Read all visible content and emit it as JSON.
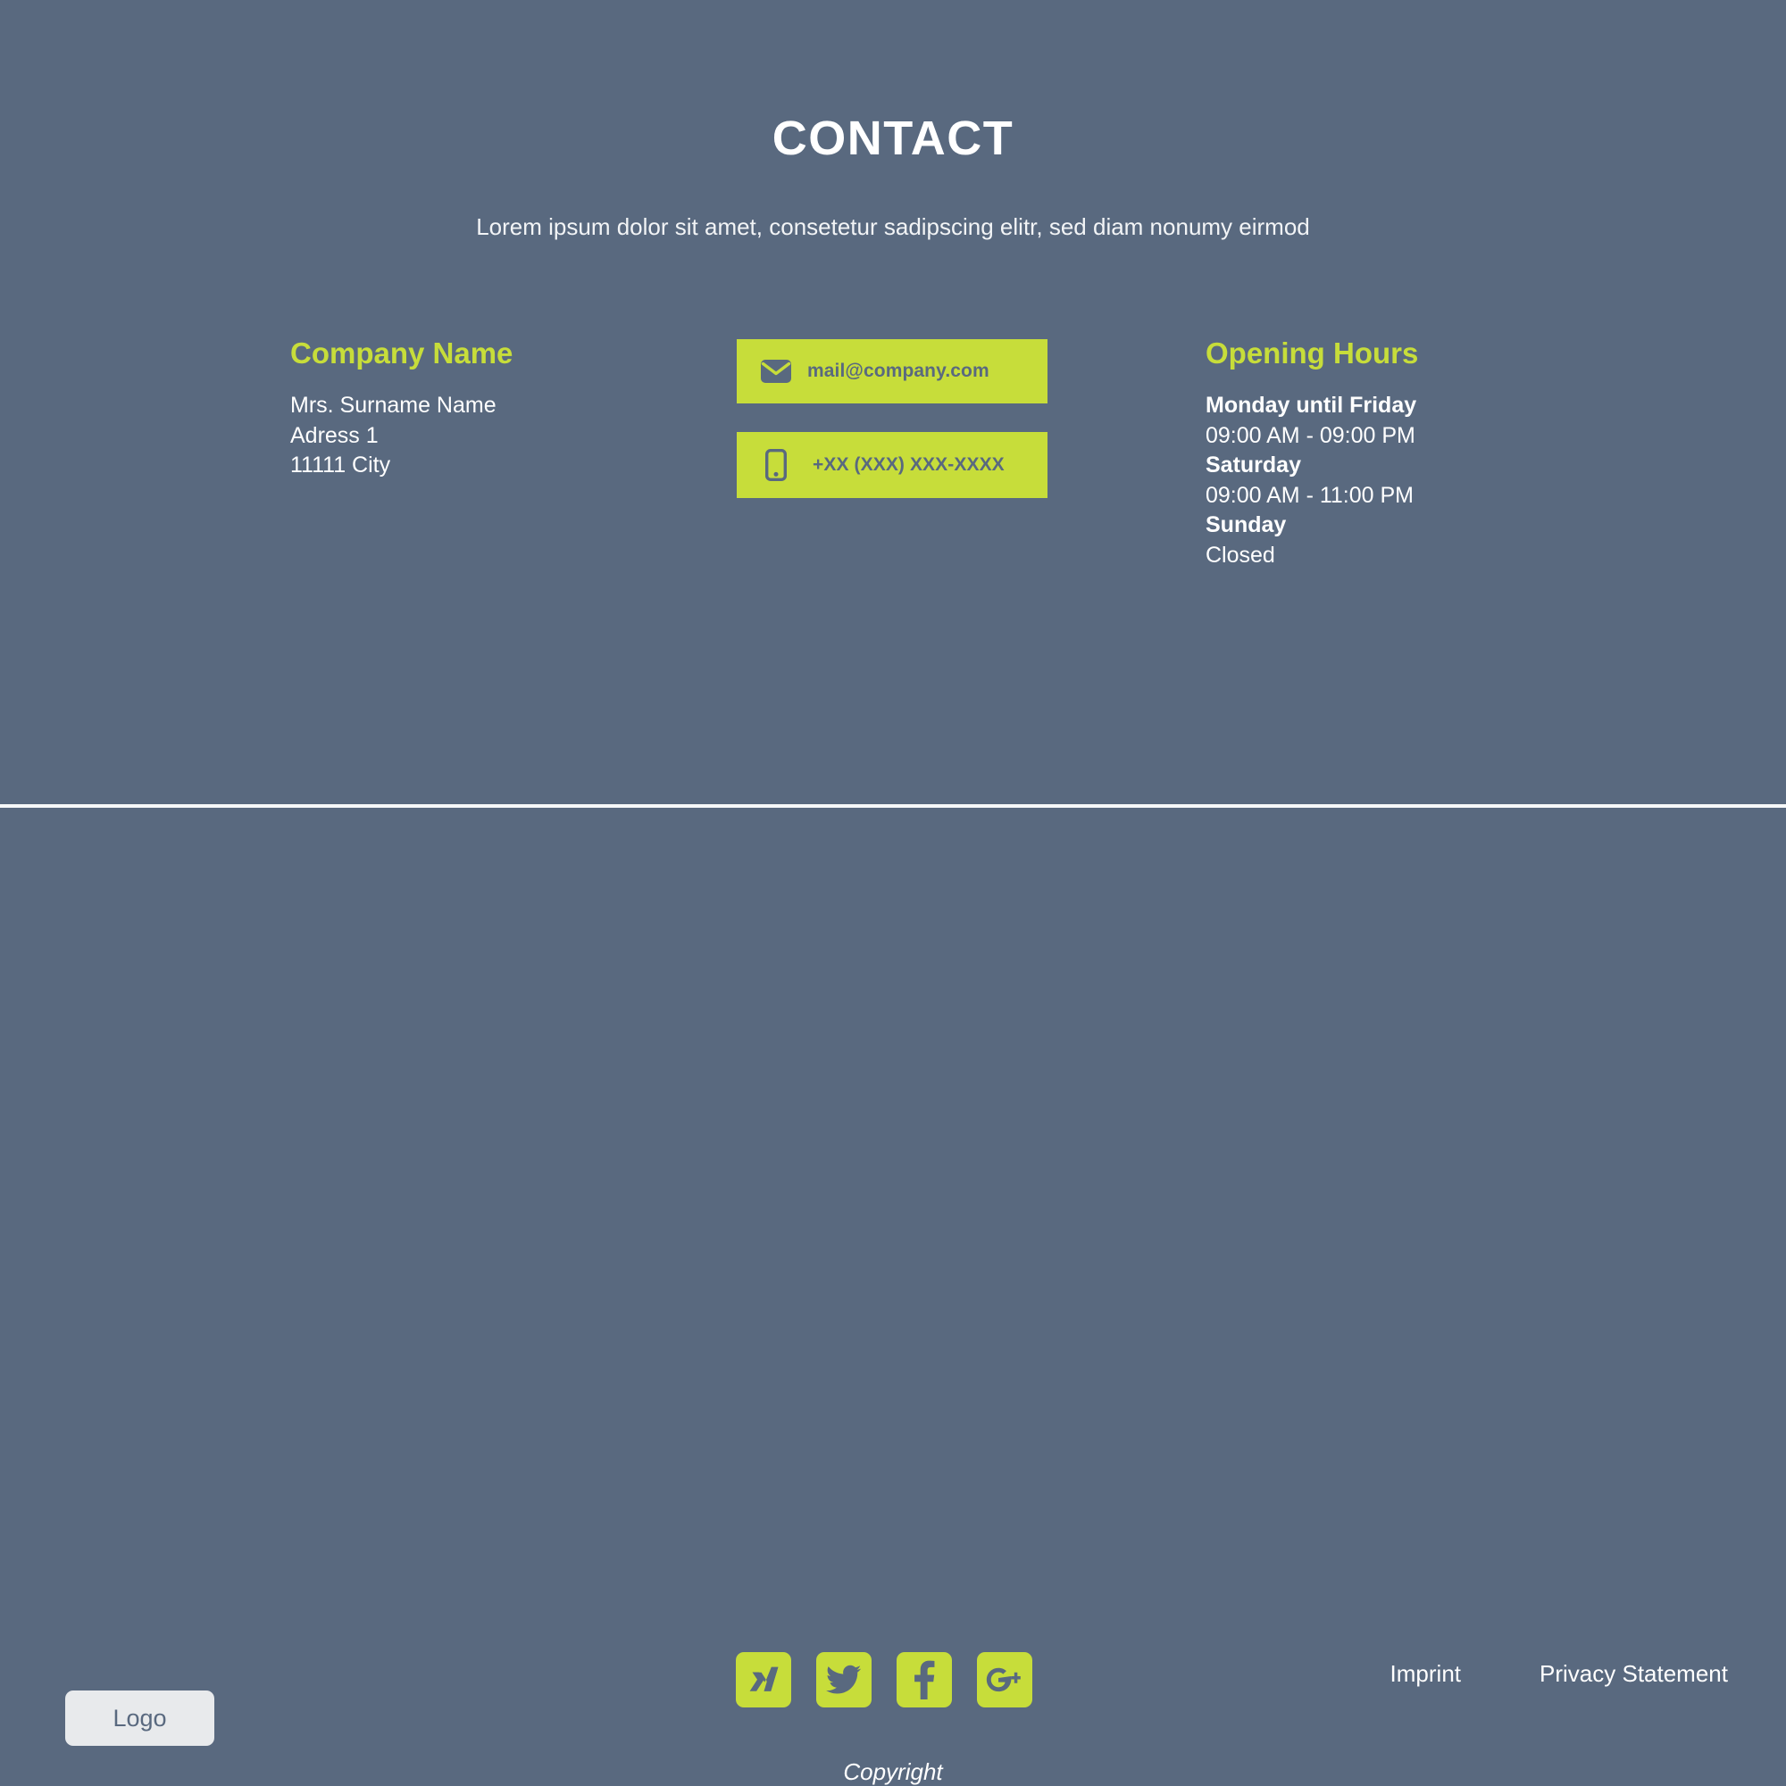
{
  "section": {
    "title": "CONTACT",
    "subtitle": "Lorem ipsum dolor sit amet, consetetur sadipscing elitr, sed diam nonumy eirmod"
  },
  "company": {
    "heading": "Company Name",
    "address_lines": [
      "Mrs. Surname Name",
      "Adress 1",
      "11111 City"
    ]
  },
  "contact": {
    "email_button": {
      "label": "mail@company.com",
      "icon": "envelope-icon"
    },
    "phone_button": {
      "label": "+XX (XXX) XXX-XXXX",
      "icon": "mobile-phone-icon"
    }
  },
  "opening_hours": {
    "heading": "Opening Hours",
    "entries": [
      {
        "day": "Monday until Friday",
        "time": "09:00 AM - 09:00 PM"
      },
      {
        "day": "Saturday",
        "time": "09:00 AM - 11:00 PM"
      },
      {
        "day": "Sunday",
        "time": "Closed"
      }
    ]
  },
  "footer": {
    "logo_label": "Logo",
    "social": [
      {
        "name": "xing-icon",
        "label": "Xing"
      },
      {
        "name": "twitter-icon",
        "label": "Twitter"
      },
      {
        "name": "facebook-icon",
        "label": "Facebook"
      },
      {
        "name": "google-plus-icon",
        "label": "Google Plus"
      }
    ],
    "links": [
      {
        "label": "Imprint"
      },
      {
        "label": "Privacy Statement"
      }
    ],
    "copyright": "Copyright"
  },
  "colors": {
    "background": "#59697f",
    "accent": "#c7dd3a",
    "text": "#ffffff",
    "logo_background": "#e8eaec"
  }
}
